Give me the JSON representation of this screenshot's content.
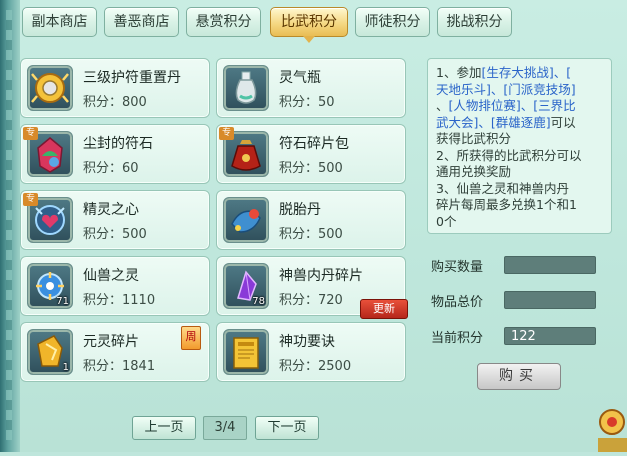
{
  "tabs": [
    {
      "label": "副本商店",
      "active": false
    },
    {
      "label": "善恶商店",
      "active": false
    },
    {
      "label": "悬赏积分",
      "active": false
    },
    {
      "label": "比武积分",
      "active": true
    },
    {
      "label": "师徒积分",
      "active": false
    },
    {
      "label": "挑战积分",
      "active": false
    }
  ],
  "price_prefix": "积分：",
  "items": [
    {
      "name": "三级护符重置丹",
      "price": "积分：800",
      "icon": "amulet-reset-pill-icon"
    },
    {
      "name": "灵气瓶",
      "price": "积分：50",
      "icon": "spirit-vase-icon"
    },
    {
      "name": "尘封的符石",
      "price": "积分：60",
      "icon": "sealed-rune-stone-icon",
      "tag": "专"
    },
    {
      "name": "符石碎片包",
      "price": "积分：500",
      "icon": "rune-fragment-bag-icon",
      "tag": "专"
    },
    {
      "name": "精灵之心",
      "price": "积分：500",
      "icon": "spirit-heart-icon",
      "tag": "专"
    },
    {
      "name": "脱胎丹",
      "price": "积分：500",
      "icon": "rebirth-pill-icon"
    },
    {
      "name": "仙兽之灵",
      "price": "积分：1110",
      "icon": "divine-beast-soul-icon",
      "qty": "71"
    },
    {
      "name": "神兽内丹碎片",
      "price": "积分：720",
      "icon": "beast-core-fragment-icon",
      "qty": "78",
      "badge": "更新"
    },
    {
      "name": "元灵碎片",
      "price": "积分：1841",
      "icon": "yuanling-fragment-icon",
      "qty": "1",
      "badge": "周"
    },
    {
      "name": "神功要诀",
      "price": "积分：2500",
      "icon": "martial-manual-icon"
    }
  ],
  "pagination": {
    "prev": "上一页",
    "page": "3/4",
    "next": "下一页"
  },
  "description": {
    "l1a": "1、参加",
    "l1b": "[生存大挑战]、[",
    "l2": "天地乐斗]、[门派竞技场]",
    "l3a": "、",
    "l3b": "[人物排位赛]、[三界比",
    "l4a": "武大会]、[群雄逐鹿]",
    "l4b": "可以",
    "l5": "获得比武积分",
    "l6": "2、所获得的比武积分可以",
    "l7": "通用兑换奖励",
    "l8": "3、仙兽之灵和神兽内丹",
    "l9": "碎片每周最多兑换1个和1",
    "l10": "0个"
  },
  "fields": {
    "quantity_label": "购买数量",
    "quantity_value": "",
    "total_label": "物品总价",
    "total_value": "",
    "current_label": "当前积分",
    "current_value": "122"
  },
  "buy_label": "购买",
  "colors": {
    "accent_active_tab": "#e9bd54",
    "link_blue": "#2a64c9",
    "new_badge": "#c7301f"
  }
}
